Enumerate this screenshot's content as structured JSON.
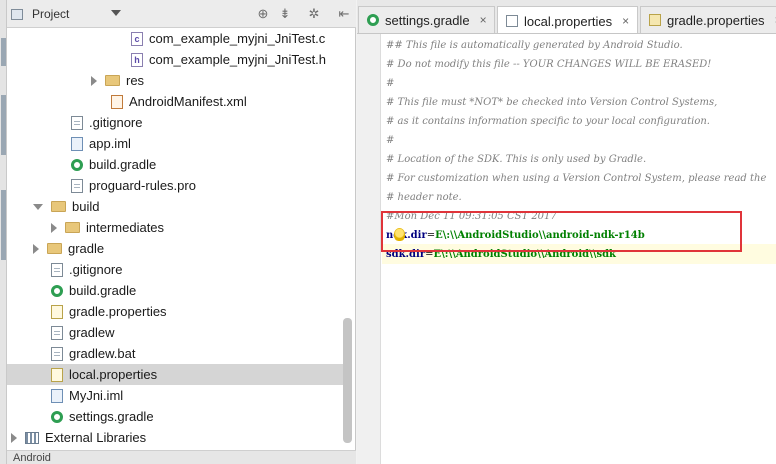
{
  "project_panel": {
    "selector_label": "Project",
    "tree": [
      {
        "label": "com_example_myjni_JniTest.c",
        "icon": "c-file-icon"
      },
      {
        "label": "com_example_myjni_JniTest.h",
        "icon": "c-header-icon"
      },
      {
        "label": "res",
        "icon": "folder-icon"
      },
      {
        "label": "AndroidManifest.xml",
        "icon": "xml-file-icon"
      },
      {
        "label": ".gitignore",
        "icon": "file-icon"
      },
      {
        "label": "app.iml",
        "icon": "iml-file-icon"
      },
      {
        "label": "build.gradle",
        "icon": "gradle-icon"
      },
      {
        "label": "proguard-rules.pro",
        "icon": "file-icon"
      },
      {
        "label": "build",
        "icon": "folder-icon"
      },
      {
        "label": "intermediates",
        "icon": "folder-icon"
      },
      {
        "label": "gradle",
        "icon": "folder-icon"
      },
      {
        "label": ".gitignore",
        "icon": "file-icon"
      },
      {
        "label": "build.gradle",
        "icon": "gradle-icon"
      },
      {
        "label": "gradle.properties",
        "icon": "properties-file-icon"
      },
      {
        "label": "gradlew",
        "icon": "file-icon"
      },
      {
        "label": "gradlew.bat",
        "icon": "file-icon"
      },
      {
        "label": "local.properties",
        "icon": "properties-file-icon",
        "selected": true
      },
      {
        "label": "MyJni.iml",
        "icon": "iml-file-icon"
      },
      {
        "label": "settings.gradle",
        "icon": "gradle-icon"
      },
      {
        "label": "External Libraries",
        "icon": "library-icon"
      }
    ],
    "bottom_tab": "Android"
  },
  "editor": {
    "tabs": [
      {
        "label": "settings.gradle",
        "icon": "gradle-icon",
        "close": "×"
      },
      {
        "label": "local.properties",
        "icon": "properties-file-icon",
        "close": "×",
        "active": true
      },
      {
        "label": "gradle.properties",
        "icon": "gradle-properties-icon",
        "close": "×"
      }
    ],
    "code": {
      "line1": "## This file is automatically generated by Android Studio.",
      "line2": "# Do not modify this file -- YOUR CHANGES WILL BE ERASED!",
      "line3": "#",
      "line4": "# This file must *NOT* be checked into Version Control Systems,",
      "line5": "# as it contains information specific to your local configuration.",
      "line6": "#",
      "line7": "# Location of the SDK. This is only used by Gradle.",
      "line8": "# For customization when using a Version Control System, please read the",
      "line9": "# header note.",
      "line10": "#Mon Dec 11 09:31:05 CST 2017",
      "ndk_key": "ndk.dir",
      "ndk_eq": "=",
      "ndk_val": "E\\:\\\\AndroidStudio\\\\android-ndk-r14b",
      "sdk_key": "sdk.dir",
      "sdk_eq": "=",
      "sdk_val": "E\\:\\\\AndroidStudio\\\\Android\\\\sdk"
    }
  },
  "colors": {
    "highlight_box": "#e0343a",
    "comment": "#808080",
    "property_key": "#000080",
    "property_value": "#008000",
    "selection": "#d5d5d5"
  }
}
